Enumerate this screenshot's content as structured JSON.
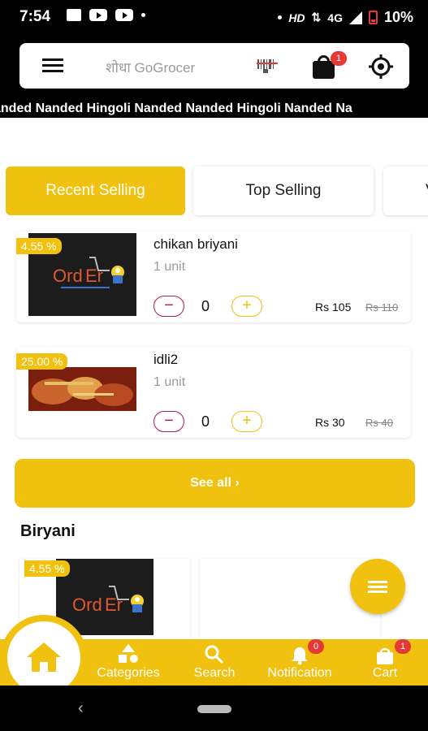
{
  "status_bar": {
    "time": "7:54",
    "network": "HD",
    "signal": "4G",
    "battery": "10%"
  },
  "header": {
    "search_placeholder": "शोधा GoGrocer",
    "cart_badge": "1",
    "icons": [
      "hamburger-menu-icon",
      "barcode-scan-icon",
      "shopping-bag-icon",
      "location-target-icon"
    ]
  },
  "ticker": {
    "text": "anded  Nanded Hingoli Nanded  Nanded Hingoli Nanded  Na"
  },
  "tabs": [
    {
      "label": "Recent Selling",
      "active": true
    },
    {
      "label": "Top Selling",
      "active": false
    },
    {
      "label": "V",
      "active": false
    }
  ],
  "products": [
    {
      "name": "chikan briyani",
      "unit": "1 unit",
      "discount": "4.55 %",
      "qty": "0",
      "price": "Rs 105",
      "mrp": "Rs 110"
    },
    {
      "name": "idli2",
      "unit": "1 unit",
      "discount": "25.00 %",
      "qty": "0",
      "price": "Rs 30",
      "mrp": "Rs 40"
    }
  ],
  "see_all_label": "See all",
  "section": {
    "title": "Biryani",
    "cards": [
      {
        "discount": "4.55 %"
      }
    ]
  },
  "bottom_nav": {
    "items": [
      {
        "label": "Categories",
        "icon": "categories-icon"
      },
      {
        "label": "Search",
        "icon": "search-icon"
      },
      {
        "label": "Notification",
        "icon": "bell-icon",
        "badge": "0"
      },
      {
        "label": "Cart",
        "icon": "cart-bag-icon",
        "badge": "1"
      }
    ]
  },
  "colors": {
    "accent": "#f0c10e",
    "badge": "#e53935",
    "minus": "#b71c3c"
  }
}
